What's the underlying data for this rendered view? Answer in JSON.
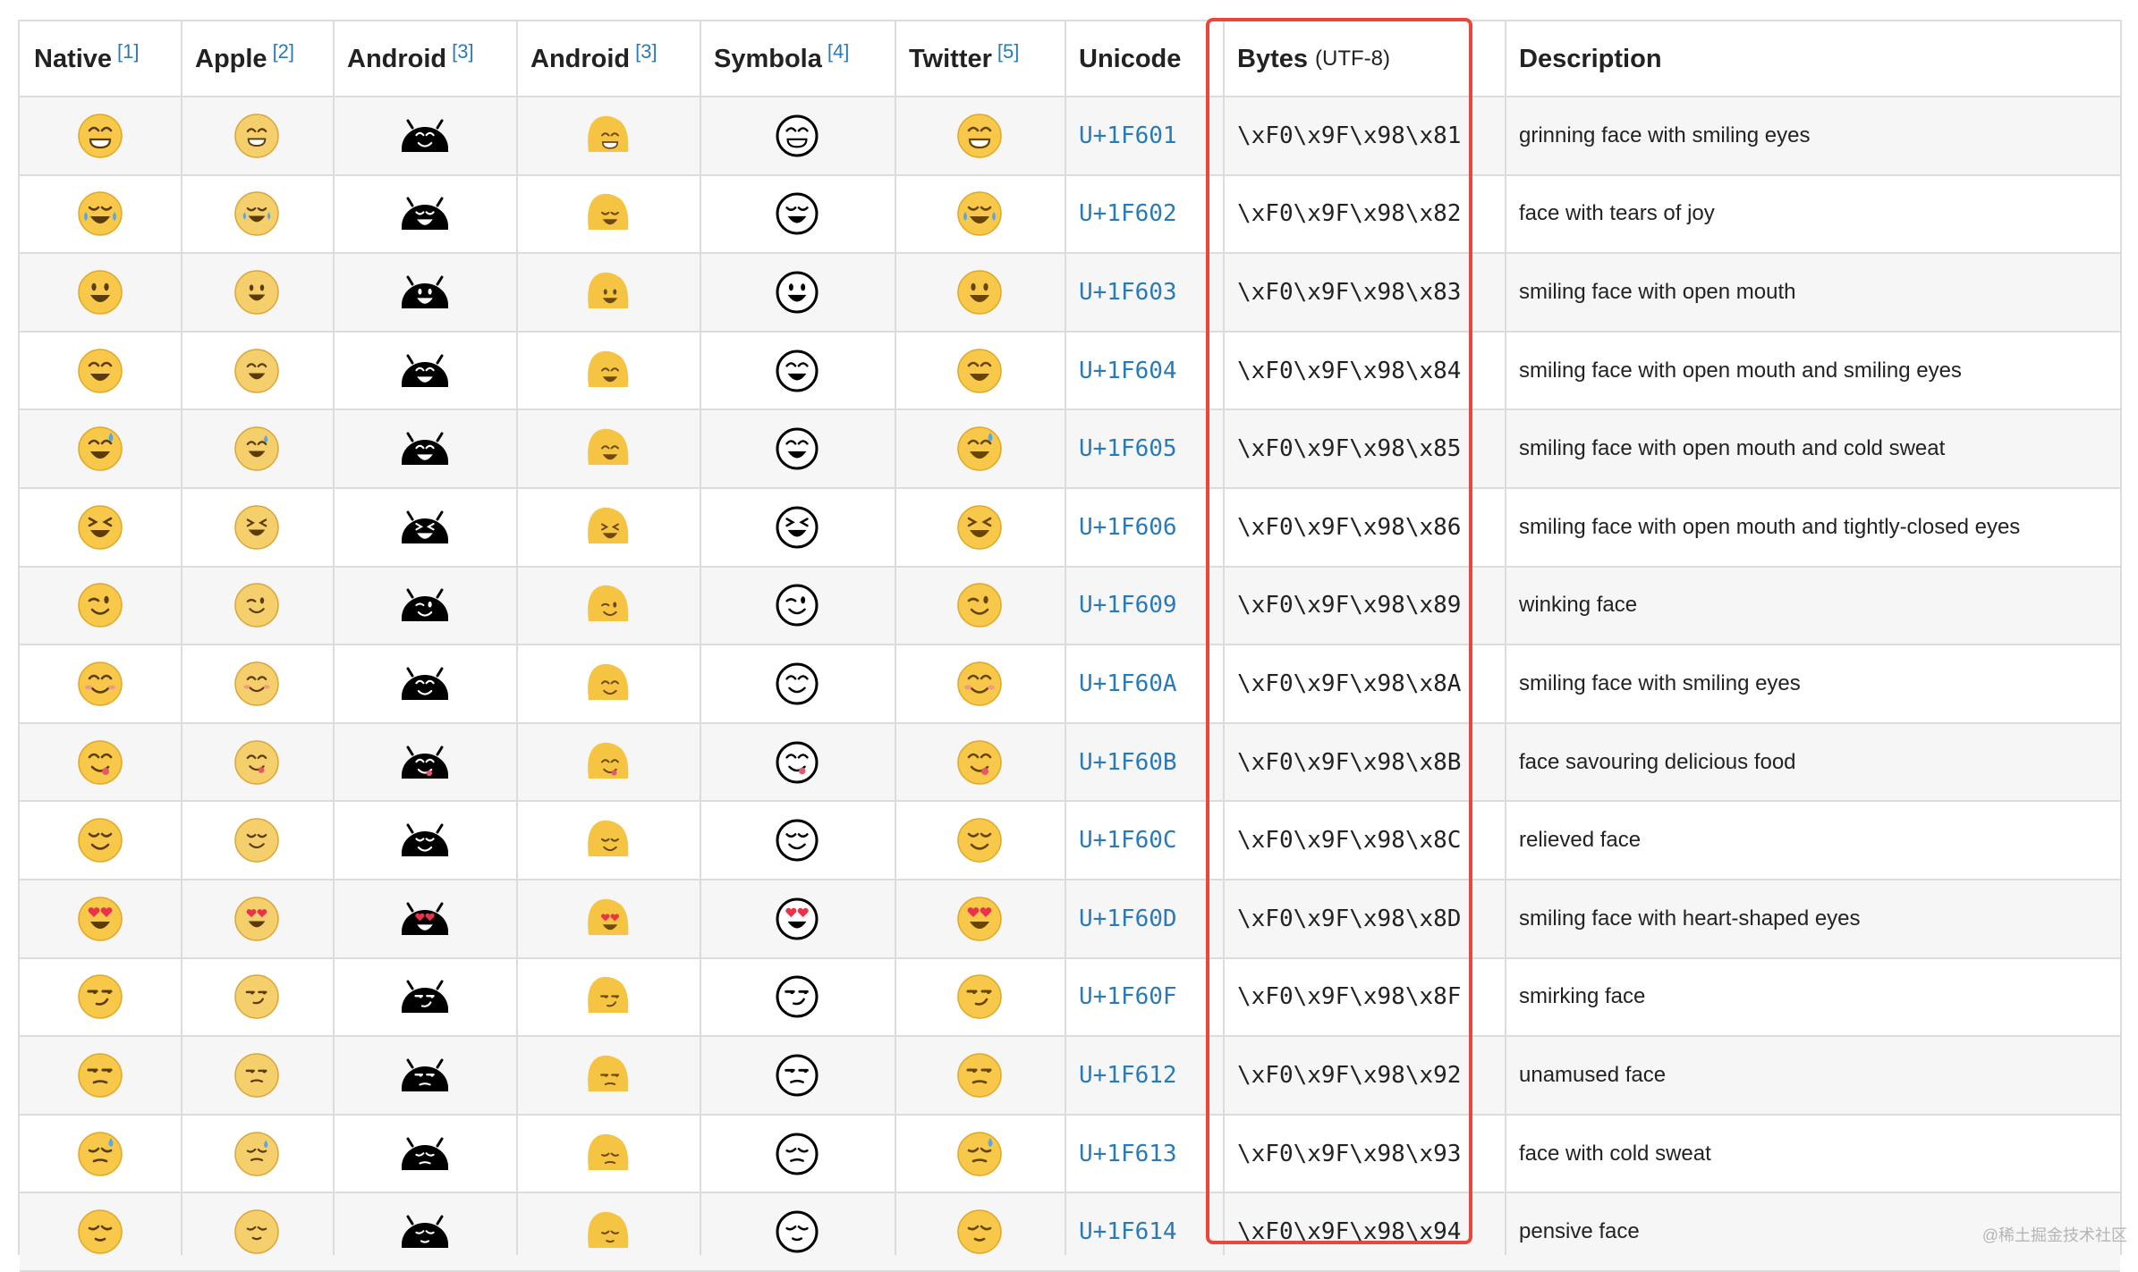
{
  "headers": [
    {
      "label": "Native",
      "ref": "[1]"
    },
    {
      "label": "Apple",
      "ref": "[2]"
    },
    {
      "label": "Android",
      "ref": "[3]"
    },
    {
      "label": "Android",
      "ref": "[3]"
    },
    {
      "label": "Symbola",
      "ref": "[4]"
    },
    {
      "label": "Twitter",
      "ref": "[5]"
    },
    {
      "label": "Unicode",
      "ref": ""
    },
    {
      "label": "Bytes",
      "sub": "(UTF-8)"
    },
    {
      "label": "Description",
      "ref": ""
    }
  ],
  "colors": {
    "face_yellow": "#f7c84a",
    "apple_yellow": "#f5cf6b",
    "link_blue": "#2a7ab8",
    "highlight_red": "#e8473b",
    "row_stripe": "#f6f6f6"
  },
  "rows": [
    {
      "icon": "grinning-face-smiling-eyes",
      "code": "U+1F601",
      "bytes": "\\xF0\\x9F\\x98\\x81",
      "desc": "grinning face with smiling eyes"
    },
    {
      "icon": "face-tears-of-joy",
      "code": "U+1F602",
      "bytes": "\\xF0\\x9F\\x98\\x82",
      "desc": "face with tears of joy"
    },
    {
      "icon": "smiling-face-open-mouth",
      "code": "U+1F603",
      "bytes": "\\xF0\\x9F\\x98\\x83",
      "desc": "smiling face with open mouth"
    },
    {
      "icon": "smiling-face-open-mouth-smiling-eyes",
      "code": "U+1F604",
      "bytes": "\\xF0\\x9F\\x98\\x84",
      "desc": "smiling face with open mouth and smiling eyes"
    },
    {
      "icon": "smiling-face-open-mouth-cold-sweat",
      "code": "U+1F605",
      "bytes": "\\xF0\\x9F\\x98\\x85",
      "desc": "smiling face with open mouth and cold sweat"
    },
    {
      "icon": "smiling-face-open-mouth-closed-eyes",
      "code": "U+1F606",
      "bytes": "\\xF0\\x9F\\x98\\x86",
      "desc": "smiling face with open mouth and tightly-closed eyes"
    },
    {
      "icon": "winking-face",
      "code": "U+1F609",
      "bytes": "\\xF0\\x9F\\x98\\x89",
      "desc": "winking face"
    },
    {
      "icon": "smiling-face-smiling-eyes",
      "code": "U+1F60A",
      "bytes": "\\xF0\\x9F\\x98\\x8A",
      "desc": "smiling face with smiling eyes"
    },
    {
      "icon": "face-savouring-food",
      "code": "U+1F60B",
      "bytes": "\\xF0\\x9F\\x98\\x8B",
      "desc": "face savouring delicious food"
    },
    {
      "icon": "relieved-face",
      "code": "U+1F60C",
      "bytes": "\\xF0\\x9F\\x98\\x8C",
      "desc": "relieved face"
    },
    {
      "icon": "heart-eyes-face",
      "code": "U+1F60D",
      "bytes": "\\xF0\\x9F\\x98\\x8D",
      "desc": "smiling face with heart-shaped eyes"
    },
    {
      "icon": "smirking-face",
      "code": "U+1F60F",
      "bytes": "\\xF0\\x9F\\x98\\x8F",
      "desc": "smirking face"
    },
    {
      "icon": "unamused-face",
      "code": "U+1F612",
      "bytes": "\\xF0\\x9F\\x98\\x92",
      "desc": "unamused face"
    },
    {
      "icon": "face-cold-sweat",
      "code": "U+1F613",
      "bytes": "\\xF0\\x9F\\x98\\x93",
      "desc": "face with cold sweat"
    },
    {
      "icon": "pensive-face",
      "code": "U+1F614",
      "bytes": "\\xF0\\x9F\\x98\\x94",
      "desc": "pensive face"
    }
  ],
  "watermark": "@稀土掘金技术社区"
}
